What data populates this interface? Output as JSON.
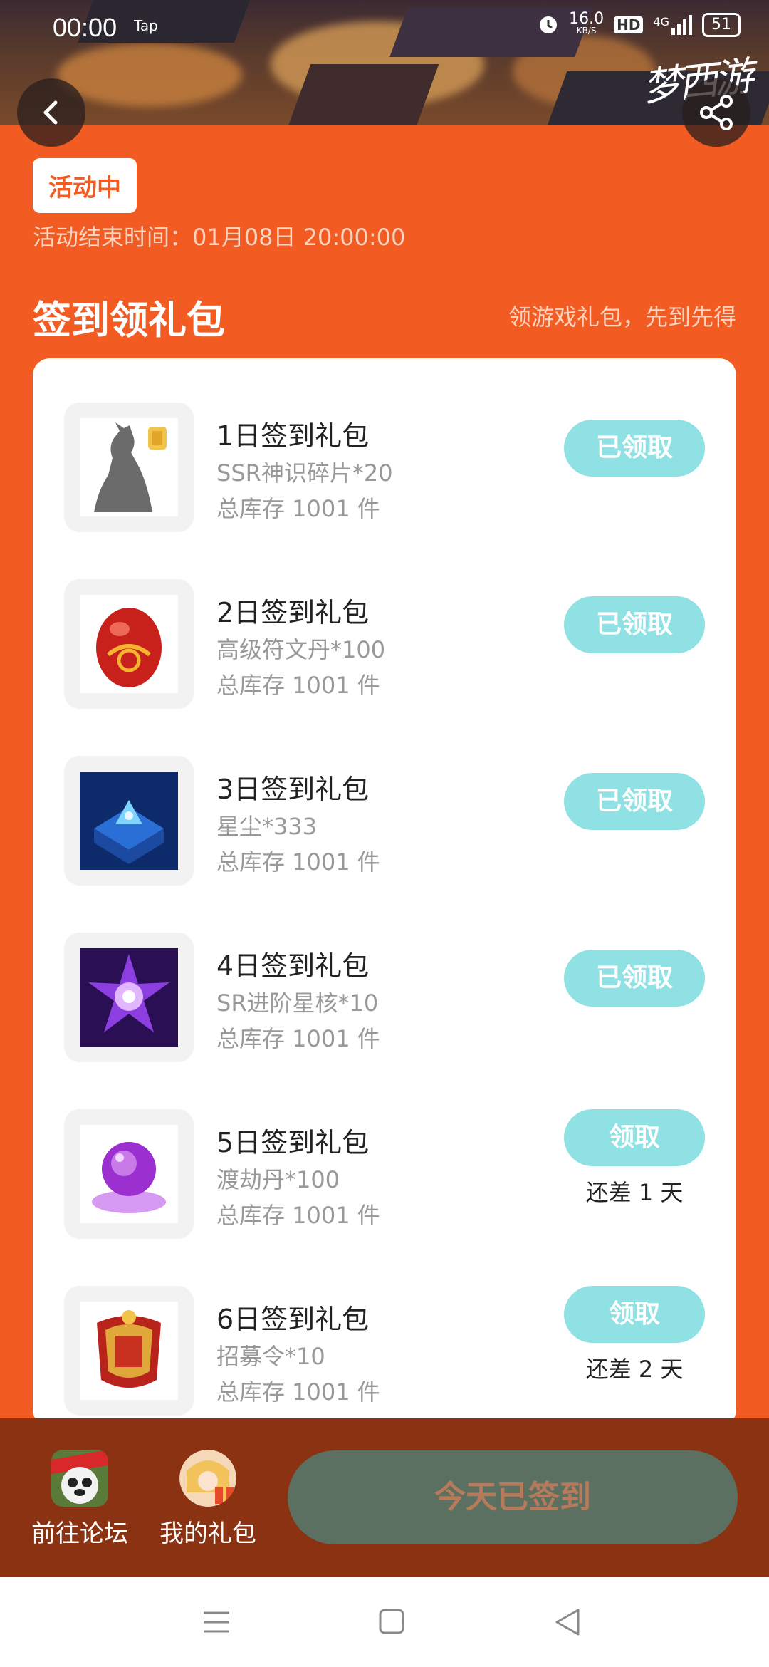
{
  "status_bar": {
    "time": "00:00",
    "tap_label": "Tap",
    "network_speed": "16.0",
    "network_unit": "KB/S",
    "hd": "HD",
    "signal": "4G",
    "battery": "51"
  },
  "banner": {
    "logo_text": "梦西游"
  },
  "activity": {
    "status": "活动中",
    "end_time": "活动结束时间：01月08日 20:00:00"
  },
  "section": {
    "title": "签到领礼包",
    "subtitle": "领游戏礼包，先到先得"
  },
  "gifts": [
    {
      "title": "1日签到礼包",
      "desc": "SSR神识碎片*20",
      "stock": "总库存 1001 件",
      "button": "已领取",
      "remaining": ""
    },
    {
      "title": "2日签到礼包",
      "desc": "高级符文丹*100",
      "stock": "总库存 1001 件",
      "button": "已领取",
      "remaining": ""
    },
    {
      "title": "3日签到礼包",
      "desc": "星尘*333",
      "stock": "总库存 1001 件",
      "button": "已领取",
      "remaining": ""
    },
    {
      "title": "4日签到礼包",
      "desc": "SR进阶星核*10",
      "stock": "总库存 1001 件",
      "button": "已领取",
      "remaining": ""
    },
    {
      "title": "5日签到礼包",
      "desc": "渡劫丹*100",
      "stock": "总库存 1001 件",
      "button": "领取",
      "remaining": "还差 1 天"
    },
    {
      "title": "6日签到礼包",
      "desc": "招募令*10",
      "stock": "总库存 1001 件",
      "button": "领取",
      "remaining": "还差 2 天"
    }
  ],
  "bottom": {
    "forum_label": "前往论坛",
    "my_gifts_label": "我的礼包",
    "signed_label": "今天已签到"
  },
  "colors": {
    "accent": "#f25c22",
    "claim_button": "#8fe1e3",
    "bottom_bar": "#8a3212",
    "signed_button": "#5b7060"
  },
  "icons": [
    "back-arrow-icon",
    "share-icon",
    "menu-icon",
    "home-square-icon",
    "back-triangle-icon"
  ]
}
